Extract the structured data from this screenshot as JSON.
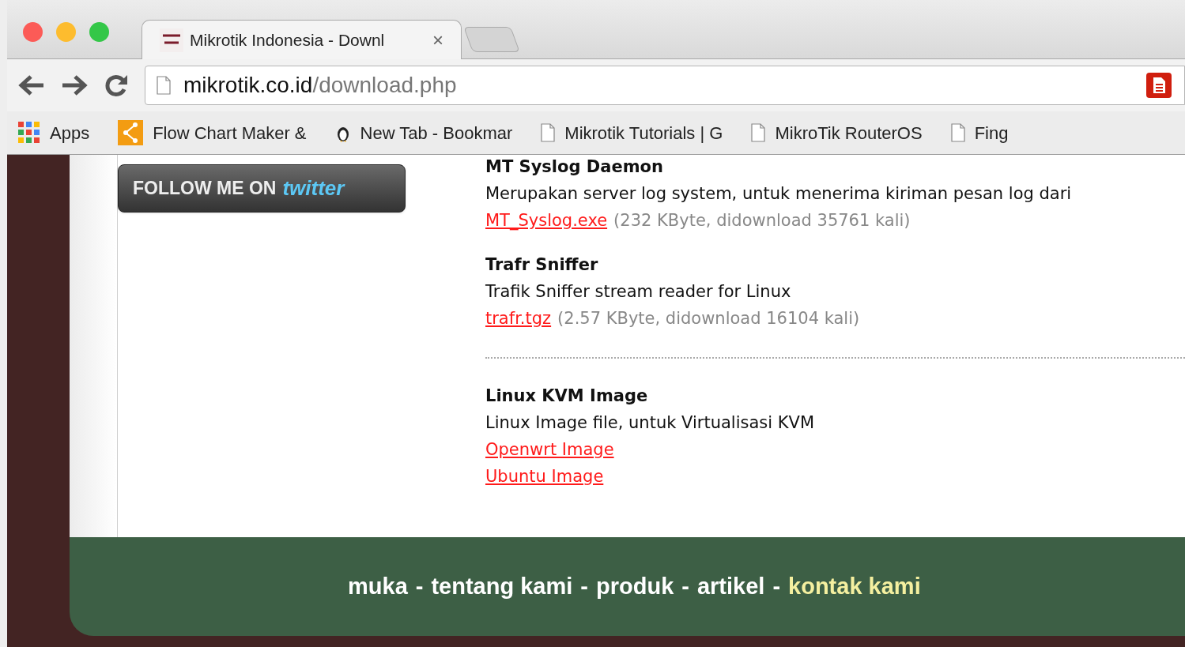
{
  "browser": {
    "tab": {
      "title": "Mikrotik Indonesia - Downl",
      "close": "×"
    },
    "url": {
      "host": "mikrotik.co.id",
      "path": "/download.php"
    },
    "bookmarks": [
      {
        "label": "Apps",
        "kind": "apps"
      },
      {
        "label": "Flow Chart Maker &",
        "kind": "flow"
      },
      {
        "label": "New Tab - Bookmar",
        "kind": "penguin"
      },
      {
        "label": "Mikrotik Tutorials | G",
        "kind": "page"
      },
      {
        "label": "MikroTik RouterOS",
        "kind": "page"
      },
      {
        "label": "Fing",
        "kind": "page"
      }
    ]
  },
  "sidebar": {
    "follow_button": {
      "label": "FOLLOW ME ON",
      "brand": "twitter"
    }
  },
  "downloads": [
    {
      "title": "MT Syslog Daemon",
      "description": "Merupakan server log system, untuk menerima kiriman pesan log dari",
      "links": [
        {
          "label": "MT_Syslog.exe",
          "info": "(232 KByte, didownload 35761 kali)"
        }
      ],
      "kind": "entry"
    },
    {
      "title": "Trafr Sniffer",
      "description": "Trafik Sniffer stream reader for Linux",
      "links": [
        {
          "label": "trafr.tgz",
          "info": "(2.57 KByte, didownload 16104 kali)"
        }
      ],
      "kind": "entry"
    },
    {
      "kind": "divider"
    },
    {
      "title": "Linux KVM Image",
      "description": "Linux Image file, untuk Virtualisasi KVM",
      "links": [
        {
          "label": "Openwrt Image"
        },
        {
          "label": "Ubuntu Image"
        }
      ],
      "kind": "entry"
    }
  ],
  "footer": {
    "links": [
      {
        "label": "muka",
        "selected": false
      },
      {
        "label": "tentang kami",
        "selected": false
      },
      {
        "label": "produk",
        "selected": false
      },
      {
        "label": "artikel",
        "selected": false
      },
      {
        "label": "kontak kami",
        "selected": true
      }
    ],
    "separator": "-"
  }
}
